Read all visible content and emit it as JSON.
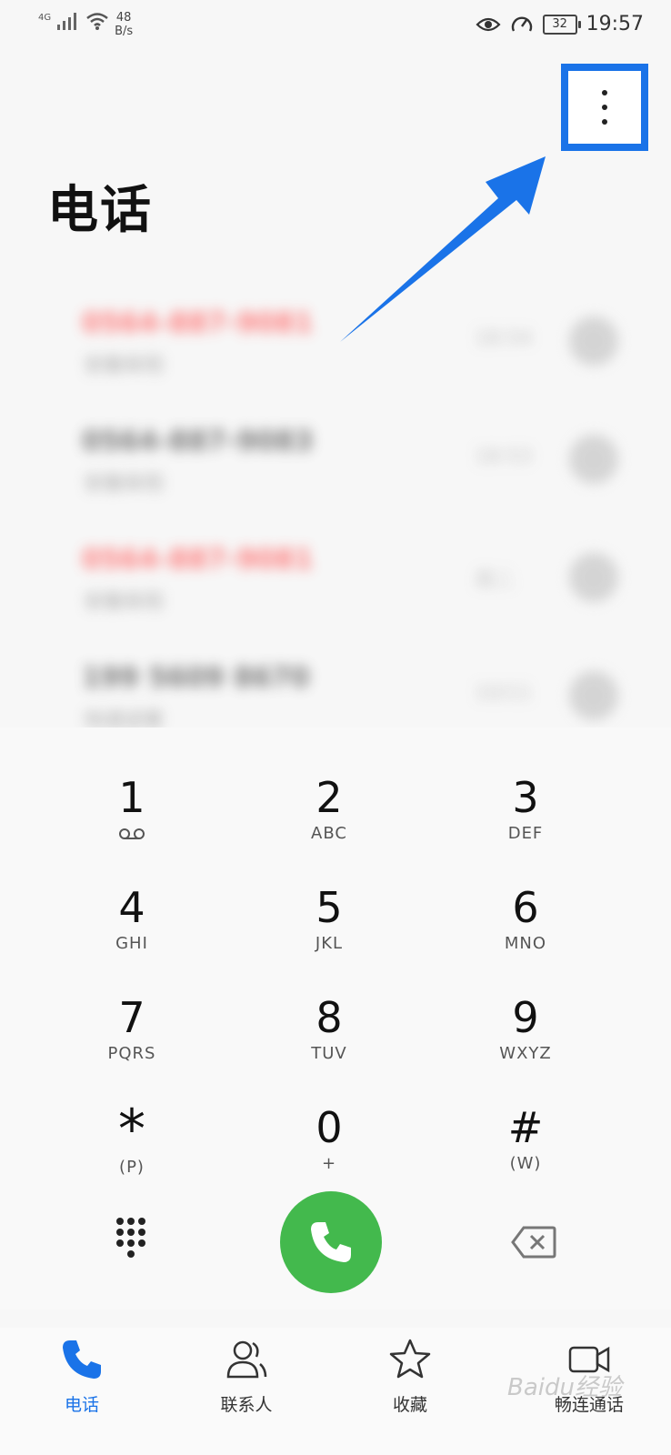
{
  "status_bar": {
    "network": "4G",
    "speed_value": "48",
    "speed_unit": "B/s",
    "battery": "32",
    "time": "19:57",
    "icons": [
      "signal-icon",
      "wifi-icon",
      "eye-icon",
      "speed-icon",
      "battery-icon"
    ]
  },
  "header": {
    "title": "电话",
    "more_icon": "more-vertical-icon",
    "highlight_color": "#1a73e8"
  },
  "call_log": [
    {
      "number": "0564-887-9081",
      "sub": "安徽阜阳",
      "time": "18:54",
      "missed": true
    },
    {
      "number": "0564-887-9083",
      "sub": "安徽阜阳",
      "time": "18:53",
      "missed": false
    },
    {
      "number": "0564-887-9081",
      "sub": "安徽阜阳",
      "time": "周二",
      "missed": true
    },
    {
      "number": "199 5609 8670",
      "sub": "快递送餐",
      "time": "10/11",
      "missed": false
    }
  ],
  "dialpad": {
    "keys": [
      {
        "digit": "1",
        "letters": ""
      },
      {
        "digit": "2",
        "letters": "ABC"
      },
      {
        "digit": "3",
        "letters": "DEF"
      },
      {
        "digit": "4",
        "letters": "GHI"
      },
      {
        "digit": "5",
        "letters": "JKL"
      },
      {
        "digit": "6",
        "letters": "MNO"
      },
      {
        "digit": "7",
        "letters": "PQRS"
      },
      {
        "digit": "8",
        "letters": "TUV"
      },
      {
        "digit": "9",
        "letters": "WXYZ"
      },
      {
        "digit": "*",
        "letters": "(P)"
      },
      {
        "digit": "0",
        "letters": "+"
      },
      {
        "digit": "#",
        "letters": "(W)"
      }
    ],
    "call_color": "#43b94d"
  },
  "tabs": [
    {
      "label": "电话",
      "icon": "phone-icon",
      "active": true
    },
    {
      "label": "联系人",
      "icon": "contacts-icon",
      "active": false
    },
    {
      "label": "收藏",
      "icon": "star-icon",
      "active": false
    },
    {
      "label": "畅连通话",
      "icon": "video-call-icon",
      "active": false
    }
  ],
  "watermark": "Baidu经验"
}
